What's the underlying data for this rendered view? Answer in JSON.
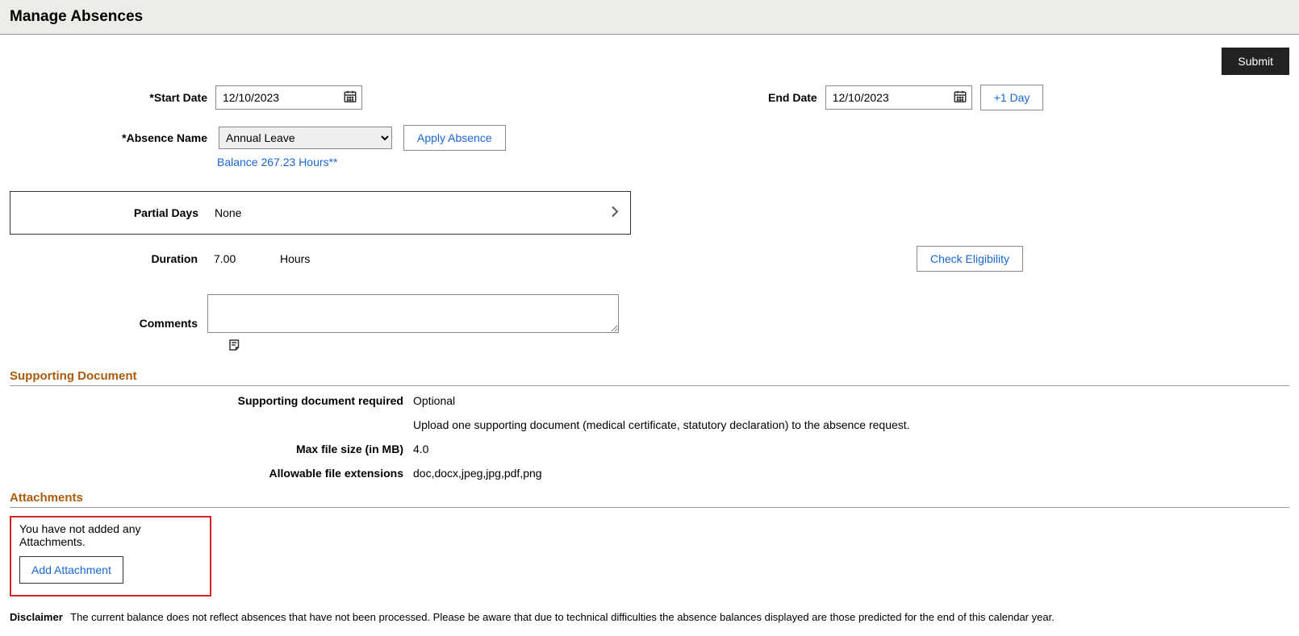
{
  "header": {
    "title": "Manage Absences"
  },
  "actions": {
    "submit": "Submit",
    "plus_day": "+1 Day",
    "apply_absence": "Apply Absence",
    "check_eligibility": "Check Eligibility",
    "add_attachment": "Add Attachment"
  },
  "form": {
    "start_date_label": "*Start Date",
    "start_date_value": "12/10/2023",
    "end_date_label": "End Date",
    "end_date_value": "12/10/2023",
    "absence_name_label": "*Absence Name",
    "absence_name_value": "Annual Leave",
    "balance_link": "Balance 267.23 Hours**",
    "partial_days_label": "Partial Days",
    "partial_days_value": "None",
    "duration_label": "Duration",
    "duration_value": "7.00",
    "duration_unit": "Hours",
    "comments_label": "Comments"
  },
  "supporting": {
    "header": "Supporting Document",
    "required_label": "Supporting document required",
    "required_value": "Optional",
    "upload_hint": "Upload one supporting document (medical certificate, statutory declaration) to the absence request.",
    "max_size_label": "Max file size (in MB)",
    "max_size_value": "4.0",
    "ext_label": "Allowable file extensions",
    "ext_value": "doc,docx,jpeg,jpg,pdf,png"
  },
  "attachments": {
    "header": "Attachments",
    "empty_msg": "You have not added any Attachments."
  },
  "disclaimer": {
    "label": "Disclaimer",
    "text": "The current balance does not reflect absences that have not been processed. Please be aware that due to technical difficulties the absence balances displayed are those predicted for the end of this calendar year."
  }
}
